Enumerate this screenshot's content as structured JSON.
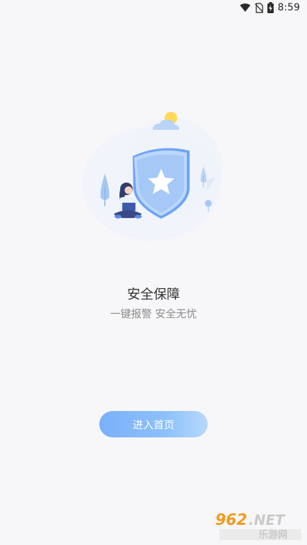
{
  "status_bar": {
    "time": "8:59",
    "icons": [
      "wifi-icon",
      "no-sim-icon",
      "battery-charging-icon"
    ]
  },
  "illustration": {
    "name": "security-shield-illustration"
  },
  "content": {
    "title": "安全保障",
    "subtitle": "一键报警 安全无忧"
  },
  "actions": {
    "enter_home_label": "进入首页"
  },
  "watermark": {
    "brand": "962.NET",
    "sub": "乐游网"
  },
  "colors": {
    "accent": "#7ab0fb",
    "accent_light": "#b7d8fb",
    "title": "#333333",
    "subtitle": "#8a8a8a",
    "background": "#f7f7f9"
  }
}
